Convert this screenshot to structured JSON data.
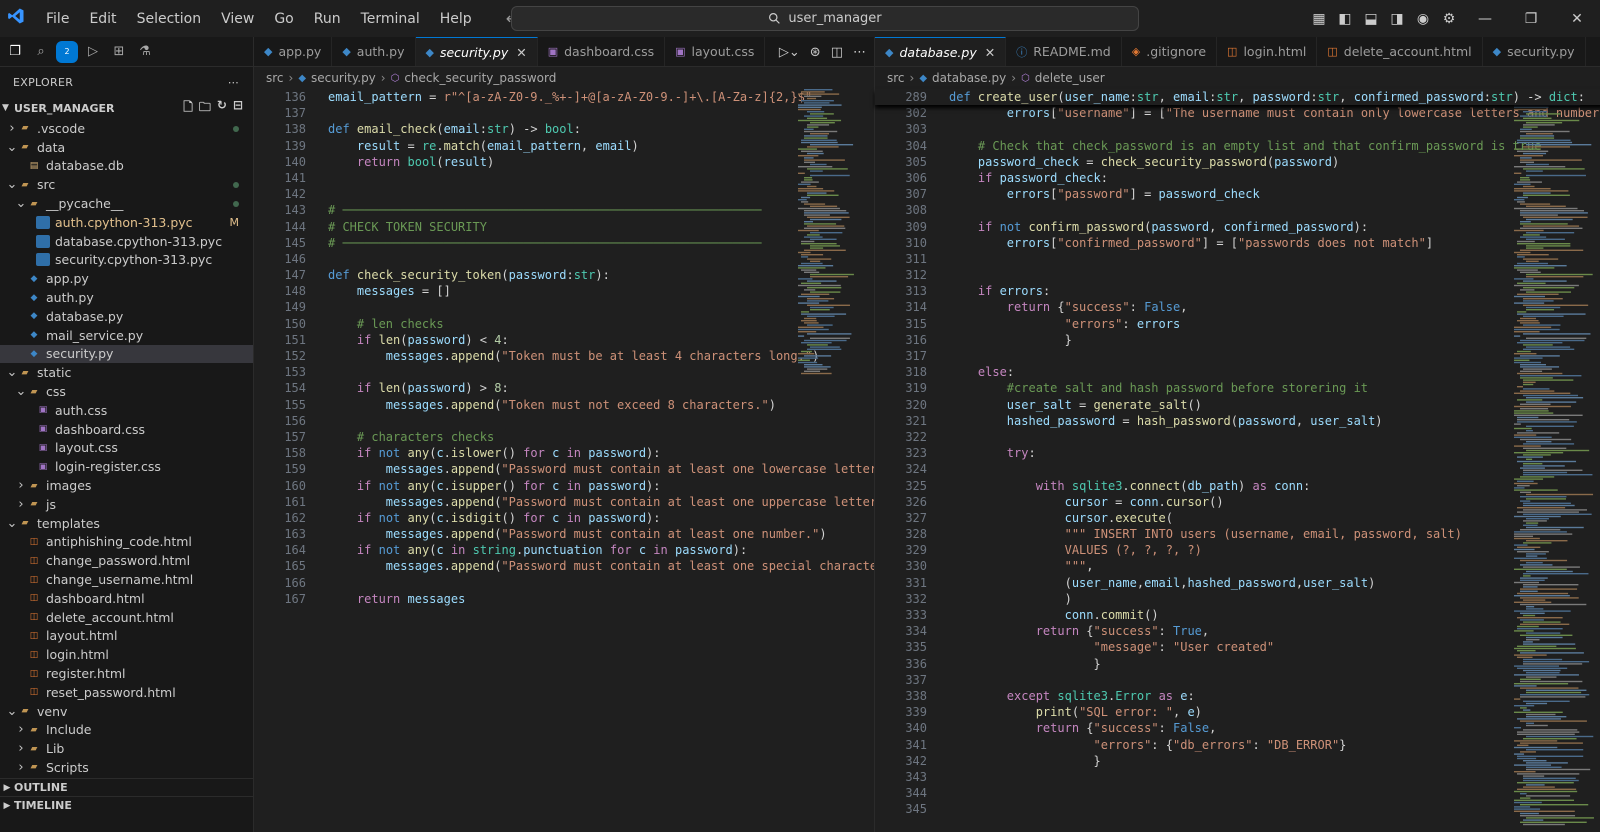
{
  "titlebar": {
    "menu": [
      "File",
      "Edit",
      "Selection",
      "View",
      "Go",
      "Run",
      "Terminal",
      "Help"
    ],
    "search": "user_manager"
  },
  "explorer": {
    "title": "EXPLORER",
    "workspace": "USER_MANAGER",
    "tree": [
      {
        "depth": 0,
        "type": "folder",
        "open": false,
        "label": ".vscode",
        "icon": "folder-icon",
        "mark": "dot"
      },
      {
        "depth": 0,
        "type": "folder",
        "open": true,
        "label": "data",
        "icon": "folder-icon"
      },
      {
        "depth": 1,
        "type": "file",
        "label": "database.db",
        "icon": "database-icon"
      },
      {
        "depth": 0,
        "type": "folder",
        "open": true,
        "label": "src",
        "icon": "folder-icon",
        "mark": "dot"
      },
      {
        "depth": 1,
        "type": "folder",
        "open": true,
        "label": "__pycache__",
        "icon": "folder-icon",
        "mark": "dot"
      },
      {
        "depth": 2,
        "type": "file",
        "label": "auth.cpython-313.pyc",
        "icon": "pyc-icon",
        "mark": "M"
      },
      {
        "depth": 2,
        "type": "file",
        "label": "database.cpython-313.pyc",
        "icon": "pyc-icon"
      },
      {
        "depth": 2,
        "type": "file",
        "label": "security.cpython-313.pyc",
        "icon": "pyc-icon"
      },
      {
        "depth": 1,
        "type": "file",
        "label": "app.py",
        "icon": "python-icon"
      },
      {
        "depth": 1,
        "type": "file",
        "label": "auth.py",
        "icon": "python-icon"
      },
      {
        "depth": 1,
        "type": "file",
        "label": "database.py",
        "icon": "python-icon"
      },
      {
        "depth": 1,
        "type": "file",
        "label": "mail_service.py",
        "icon": "python-icon"
      },
      {
        "depth": 1,
        "type": "file",
        "label": "security.py",
        "icon": "python-icon",
        "selected": true
      },
      {
        "depth": 0,
        "type": "folder",
        "open": true,
        "label": "static",
        "icon": "folder-icon"
      },
      {
        "depth": 1,
        "type": "folder",
        "open": true,
        "label": "css",
        "icon": "folder-icon"
      },
      {
        "depth": 2,
        "type": "file",
        "label": "auth.css",
        "icon": "css-icon"
      },
      {
        "depth": 2,
        "type": "file",
        "label": "dashboard.css",
        "icon": "css-icon"
      },
      {
        "depth": 2,
        "type": "file",
        "label": "layout.css",
        "icon": "css-icon"
      },
      {
        "depth": 2,
        "type": "file",
        "label": "login-register.css",
        "icon": "css-icon"
      },
      {
        "depth": 1,
        "type": "folder",
        "open": false,
        "label": "images",
        "icon": "folder-icon"
      },
      {
        "depth": 1,
        "type": "folder",
        "open": false,
        "label": "js",
        "icon": "folder-icon"
      },
      {
        "depth": 0,
        "type": "folder",
        "open": true,
        "label": "templates",
        "icon": "folder-icon"
      },
      {
        "depth": 1,
        "type": "file",
        "label": "antiphishing_code.html",
        "icon": "html-icon"
      },
      {
        "depth": 1,
        "type": "file",
        "label": "change_password.html",
        "icon": "html-icon"
      },
      {
        "depth": 1,
        "type": "file",
        "label": "change_username.html",
        "icon": "html-icon"
      },
      {
        "depth": 1,
        "type": "file",
        "label": "dashboard.html",
        "icon": "html-icon"
      },
      {
        "depth": 1,
        "type": "file",
        "label": "delete_account.html",
        "icon": "html-icon"
      },
      {
        "depth": 1,
        "type": "file",
        "label": "layout.html",
        "icon": "html-icon"
      },
      {
        "depth": 1,
        "type": "file",
        "label": "login.html",
        "icon": "html-icon"
      },
      {
        "depth": 1,
        "type": "file",
        "label": "register.html",
        "icon": "html-icon"
      },
      {
        "depth": 1,
        "type": "file",
        "label": "reset_password.html",
        "icon": "html-icon"
      },
      {
        "depth": 0,
        "type": "folder",
        "open": true,
        "label": "venv",
        "icon": "folder-icon"
      },
      {
        "depth": 1,
        "type": "folder",
        "open": false,
        "label": "Include",
        "icon": "folder-icon"
      },
      {
        "depth": 1,
        "type": "folder",
        "open": false,
        "label": "Lib",
        "icon": "folder-icon"
      },
      {
        "depth": 1,
        "type": "folder",
        "open": false,
        "label": "Scripts",
        "icon": "folder-icon"
      }
    ],
    "outline": "OUTLINE",
    "timeline": "TIMELINE"
  },
  "left_editor": {
    "tabs": [
      {
        "label": "app.py",
        "icon": "python-icon"
      },
      {
        "label": "auth.py",
        "icon": "python-icon"
      },
      {
        "label": "security.py",
        "icon": "python-icon",
        "active": true
      },
      {
        "label": "dashboard.css",
        "icon": "css-icon"
      },
      {
        "label": "layout.css",
        "icon": "css-icon"
      }
    ],
    "breadcrumb": [
      "src",
      "security.py",
      "check_security_password"
    ],
    "lines": [
      {
        "n": "136",
        "html": "<span class='v'>email_pattern</span> = <span class='s'>r\"^[a-zA-Z0-9._%+-]+@[a-zA-Z0-9.-]+\\.[A-Za-z]{2,}$\"</span>"
      },
      {
        "n": "137",
        "html": ""
      },
      {
        "n": "138",
        "html": "<span class='k'>def</span> <span class='f'>email_check</span>(<span class='v'>email</span>:<span class='t'>str</span>) -> <span class='t'>bool</span>:"
      },
      {
        "n": "139",
        "html": "    <span class='v'>result</span> = <span class='t'>re</span>.<span class='f'>match</span>(<span class='v'>email_pattern</span>, <span class='v'>email</span>)"
      },
      {
        "n": "140",
        "html": "    <span class='kc'>return</span> <span class='t'>bool</span>(<span class='v'>result</span>)"
      },
      {
        "n": "141",
        "html": ""
      },
      {
        "n": "142",
        "html": ""
      },
      {
        "n": "143",
        "html": "<span class='c'># ──────────────────────────────────────────────────────────</span>"
      },
      {
        "n": "144",
        "html": "<span class='c'># CHECK TOKEN SECURITY</span>"
      },
      {
        "n": "145",
        "html": "<span class='c'># ──────────────────────────────────────────────────────────</span>"
      },
      {
        "n": "146",
        "html": ""
      },
      {
        "n": "147",
        "html": "<span class='k'>def</span> <span class='f'>check_security_token</span>(<span class='v'>password</span>:<span class='t'>str</span>):"
      },
      {
        "n": "148",
        "html": "    <span class='v'>messages</span> = []"
      },
      {
        "n": "149",
        "html": ""
      },
      {
        "n": "150",
        "html": "    <span class='c'># len checks</span>"
      },
      {
        "n": "151",
        "html": "    <span class='kc'>if</span> <span class='f'>len</span>(<span class='v'>password</span>) &lt; <span class='n'>4</span>:"
      },
      {
        "n": "152",
        "html": "        <span class='v'>messages</span>.<span class='f'>append</span>(<span class='s'>\"Token must be at least 4 characters long.\"</span>)"
      },
      {
        "n": "153",
        "html": ""
      },
      {
        "n": "154",
        "html": "    <span class='kc'>if</span> <span class='f'>len</span>(<span class='v'>password</span>) &gt; <span class='n'>8</span>:"
      },
      {
        "n": "155",
        "html": "        <span class='v'>messages</span>.<span class='f'>append</span>(<span class='s'>\"Token must not exceed 8 characters.\"</span>)"
      },
      {
        "n": "156",
        "html": ""
      },
      {
        "n": "157",
        "html": "    <span class='c'># characters checks</span>"
      },
      {
        "n": "158",
        "html": "    <span class='kc'>if</span> <span class='k'>not</span> <span class='f'>any</span>(<span class='v'>c</span>.<span class='f'>islower</span>() <span class='kc'>for</span> <span class='v'>c</span> <span class='kc'>in</span> <span class='v'>password</span>):"
      },
      {
        "n": "159",
        "html": "        <span class='v'>messages</span>.<span class='f'>append</span>(<span class='s'>\"Password must contain at least one lowercase letter.\"</span>)"
      },
      {
        "n": "160",
        "html": "    <span class='kc'>if</span> <span class='k'>not</span> <span class='f'>any</span>(<span class='v'>c</span>.<span class='f'>isupper</span>() <span class='kc'>for</span> <span class='v'>c</span> <span class='kc'>in</span> <span class='v'>password</span>):"
      },
      {
        "n": "161",
        "html": "        <span class='v'>messages</span>.<span class='f'>append</span>(<span class='s'>\"Password must contain at least one uppercase letter.\"</span>)"
      },
      {
        "n": "162",
        "html": "    <span class='kc'>if</span> <span class='k'>not</span> <span class='f'>any</span>(<span class='v'>c</span>.<span class='f'>isdigit</span>() <span class='kc'>for</span> <span class='v'>c</span> <span class='kc'>in</span> <span class='v'>password</span>):"
      },
      {
        "n": "163",
        "html": "        <span class='v'>messages</span>.<span class='f'>append</span>(<span class='s'>\"Password must contain at least one number.\"</span>)"
      },
      {
        "n": "164",
        "html": "    <span class='kc'>if</span> <span class='k'>not</span> <span class='f'>any</span>(<span class='v'>c</span> <span class='kc'>in</span> <span class='t'>string</span>.<span class='v'>punctuation</span> <span class='kc'>for</span> <span class='v'>c</span> <span class='kc'>in</span> <span class='v'>password</span>):"
      },
      {
        "n": "165",
        "html": "        <span class='v'>messages</span>.<span class='f'>append</span>(<span class='s'>\"Password must contain at least one special character (e.g.</span>"
      },
      {
        "n": "166",
        "html": ""
      },
      {
        "n": "167",
        "html": "    <span class='kc'>return</span> <span class='v'>messages</span>"
      }
    ]
  },
  "right_editor": {
    "tabs": [
      {
        "label": "database.py",
        "icon": "python-icon",
        "active": true
      },
      {
        "label": "README.md",
        "icon": "info-icon"
      },
      {
        "label": ".gitignore",
        "icon": "git-icon"
      },
      {
        "label": "login.html",
        "icon": "html-icon"
      },
      {
        "label": "delete_account.html",
        "icon": "html-icon"
      },
      {
        "label": "security.py",
        "icon": "python-icon"
      }
    ],
    "breadcrumb": [
      "src",
      "database.py",
      "delete_user"
    ],
    "sticky": {
      "n": "289",
      "html": "<span class='k'>def</span> <span class='f'>create_user</span>(<span class='v'>user_name</span>:<span class='t'>str</span>, <span class='v'>email</span>:<span class='t'>str</span>, <span class='v'>password</span>:<span class='t'>str</span>, <span class='v'>confirmed_password</span>:<span class='t'>str</span>) -> <span class='t'>dict</span>:"
    },
    "lines": [
      {
        "n": "302",
        "html": "        <span class='v'>errors</span>[<span class='s'>\"username\"</span>] = [<span class='s'>\"The username must contain only lowercase letters and numbers\"</span>]"
      },
      {
        "n": "303",
        "html": ""
      },
      {
        "n": "304",
        "html": "    <span class='c'># Check that check_password is an empty list and that confirm_password is true</span>"
      },
      {
        "n": "305",
        "html": "    <span class='v'>password_check</span> = <span class='f'>check_security_password</span>(<span class='v'>password</span>)"
      },
      {
        "n": "306",
        "html": "    <span class='kc'>if</span> <span class='v'>password_check</span>:"
      },
      {
        "n": "307",
        "html": "        <span class='v'>errors</span>[<span class='s'>\"password\"</span>] = <span class='v'>password_check</span>"
      },
      {
        "n": "308",
        "html": ""
      },
      {
        "n": "309",
        "html": "    <span class='kc'>if</span> <span class='k'>not</span> <span class='f'>confirm_password</span>(<span class='v'>password</span>, <span class='v'>confirmed_password</span>):"
      },
      {
        "n": "310",
        "html": "        <span class='v'>errors</span>[<span class='s'>\"confirmed_password\"</span>] = [<span class='s'>\"passwords does not match\"</span>]"
      },
      {
        "n": "311",
        "html": ""
      },
      {
        "n": "312",
        "html": ""
      },
      {
        "n": "313",
        "html": "    <span class='kc'>if</span> <span class='v'>errors</span>:"
      },
      {
        "n": "314",
        "html": "        <span class='kc'>return</span> {<span class='s'>\"success\"</span>: <span class='k'>False</span>,"
      },
      {
        "n": "315",
        "html": "                <span class='s'>\"errors\"</span>: <span class='v'>errors</span>"
      },
      {
        "n": "316",
        "html": "                }"
      },
      {
        "n": "317",
        "html": ""
      },
      {
        "n": "318",
        "html": "    <span class='kc'>else</span>:"
      },
      {
        "n": "319",
        "html": "        <span class='c'>#create salt and hash password before storering it</span>"
      },
      {
        "n": "320",
        "html": "        <span class='v'>user_salt</span> = <span class='f'>generate_salt</span>()"
      },
      {
        "n": "321",
        "html": "        <span class='v'>hashed_password</span> = <span class='f'>hash_password</span>(<span class='v'>password</span>, <span class='v'>user_salt</span>)"
      },
      {
        "n": "322",
        "html": ""
      },
      {
        "n": "323",
        "html": "        <span class='kc'>try</span>:"
      },
      {
        "n": "324",
        "html": ""
      },
      {
        "n": "325",
        "html": "            <span class='kc'>with</span> <span class='t'>sqlite3</span>.<span class='f'>connect</span>(<span class='v'>db_path</span>) <span class='kc'>as</span> <span class='v'>conn</span>:"
      },
      {
        "n": "326",
        "html": "                <span class='v'>cursor</span> = <span class='v'>conn</span>.<span class='f'>cursor</span>()"
      },
      {
        "n": "327",
        "html": "                <span class='v'>cursor</span>.<span class='f'>execute</span>("
      },
      {
        "n": "328",
        "html": "                <span class='s'>\"\"\" INSERT INTO users (username, email, password, salt)</span>"
      },
      {
        "n": "329",
        "html": "<span class='s'>                VALUES (?, ?, ?, ?)</span>"
      },
      {
        "n": "330",
        "html": "<span class='s'>                \"\"\"</span>,"
      },
      {
        "n": "331",
        "html": "                (<span class='v'>user_name</span>,<span class='v'>email</span>,<span class='v'>hashed_password</span>,<span class='v'>user_salt</span>)"
      },
      {
        "n": "332",
        "html": "                )"
      },
      {
        "n": "333",
        "html": "                <span class='v'>conn</span>.<span class='f'>commit</span>()"
      },
      {
        "n": "334",
        "html": "            <span class='kc'>return</span> {<span class='s'>\"success\"</span>: <span class='k'>True</span>,"
      },
      {
        "n": "335",
        "html": "                    <span class='s'>\"message\"</span>: <span class='s'>\"User created\"</span>"
      },
      {
        "n": "336",
        "html": "                    }"
      },
      {
        "n": "337",
        "html": ""
      },
      {
        "n": "338",
        "html": "        <span class='kc'>except</span> <span class='t'>sqlite3</span>.<span class='t'>Error</span> <span class='kc'>as</span> <span class='v'>e</span>:"
      },
      {
        "n": "339",
        "html": "            <span class='f'>print</span>(<span class='s'>\"SQL error: \"</span>, <span class='v'>e</span>)"
      },
      {
        "n": "340",
        "html": "            <span class='kc'>return</span> {<span class='s'>\"success\"</span>: <span class='k'>False</span>,"
      },
      {
        "n": "341",
        "html": "                    <span class='s'>\"errors\"</span>: {<span class='s'>\"db_errors\"</span>: <span class='s'>\"DB_ERROR\"</span>}"
      },
      {
        "n": "342",
        "html": "                    }"
      },
      {
        "n": "343",
        "html": ""
      },
      {
        "n": "344",
        "html": ""
      },
      {
        "n": "345",
        "html": ""
      }
    ]
  }
}
